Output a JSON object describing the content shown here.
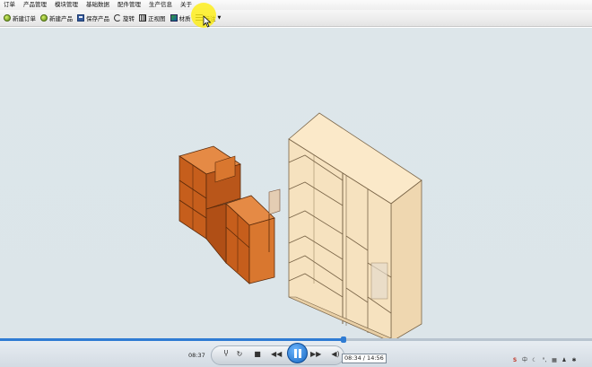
{
  "menubar": {
    "items": [
      "订单",
      "产品管理",
      "模块管理",
      "基础数据",
      "配件管理",
      "生产信息",
      "关于"
    ]
  },
  "toolbar": {
    "new_order": "新建订单",
    "new_product": "新建产品",
    "save_product": "保存产品",
    "rotate": "旋转",
    "front_view": "正视图",
    "material": "材质",
    "annotation": "标注"
  },
  "player": {
    "current_time": "08:37",
    "tooltip_time": "08:34 / 14:56",
    "progress_fraction": 0.58,
    "tray_text": "中"
  },
  "colors": {
    "viewport_bg": "#dde6ea",
    "cabinet_wood": "#c8621f",
    "wardrobe_panel": "#f6e2bf",
    "highlight": "#ffee00",
    "accent": "#2f7cd3"
  },
  "icons": [
    "new-order-icon",
    "new-product-icon",
    "save-icon",
    "rotate-icon",
    "front-view-icon",
    "material-icon",
    "annotation-icon",
    "cursor-icon",
    "play-pause-icon"
  ]
}
